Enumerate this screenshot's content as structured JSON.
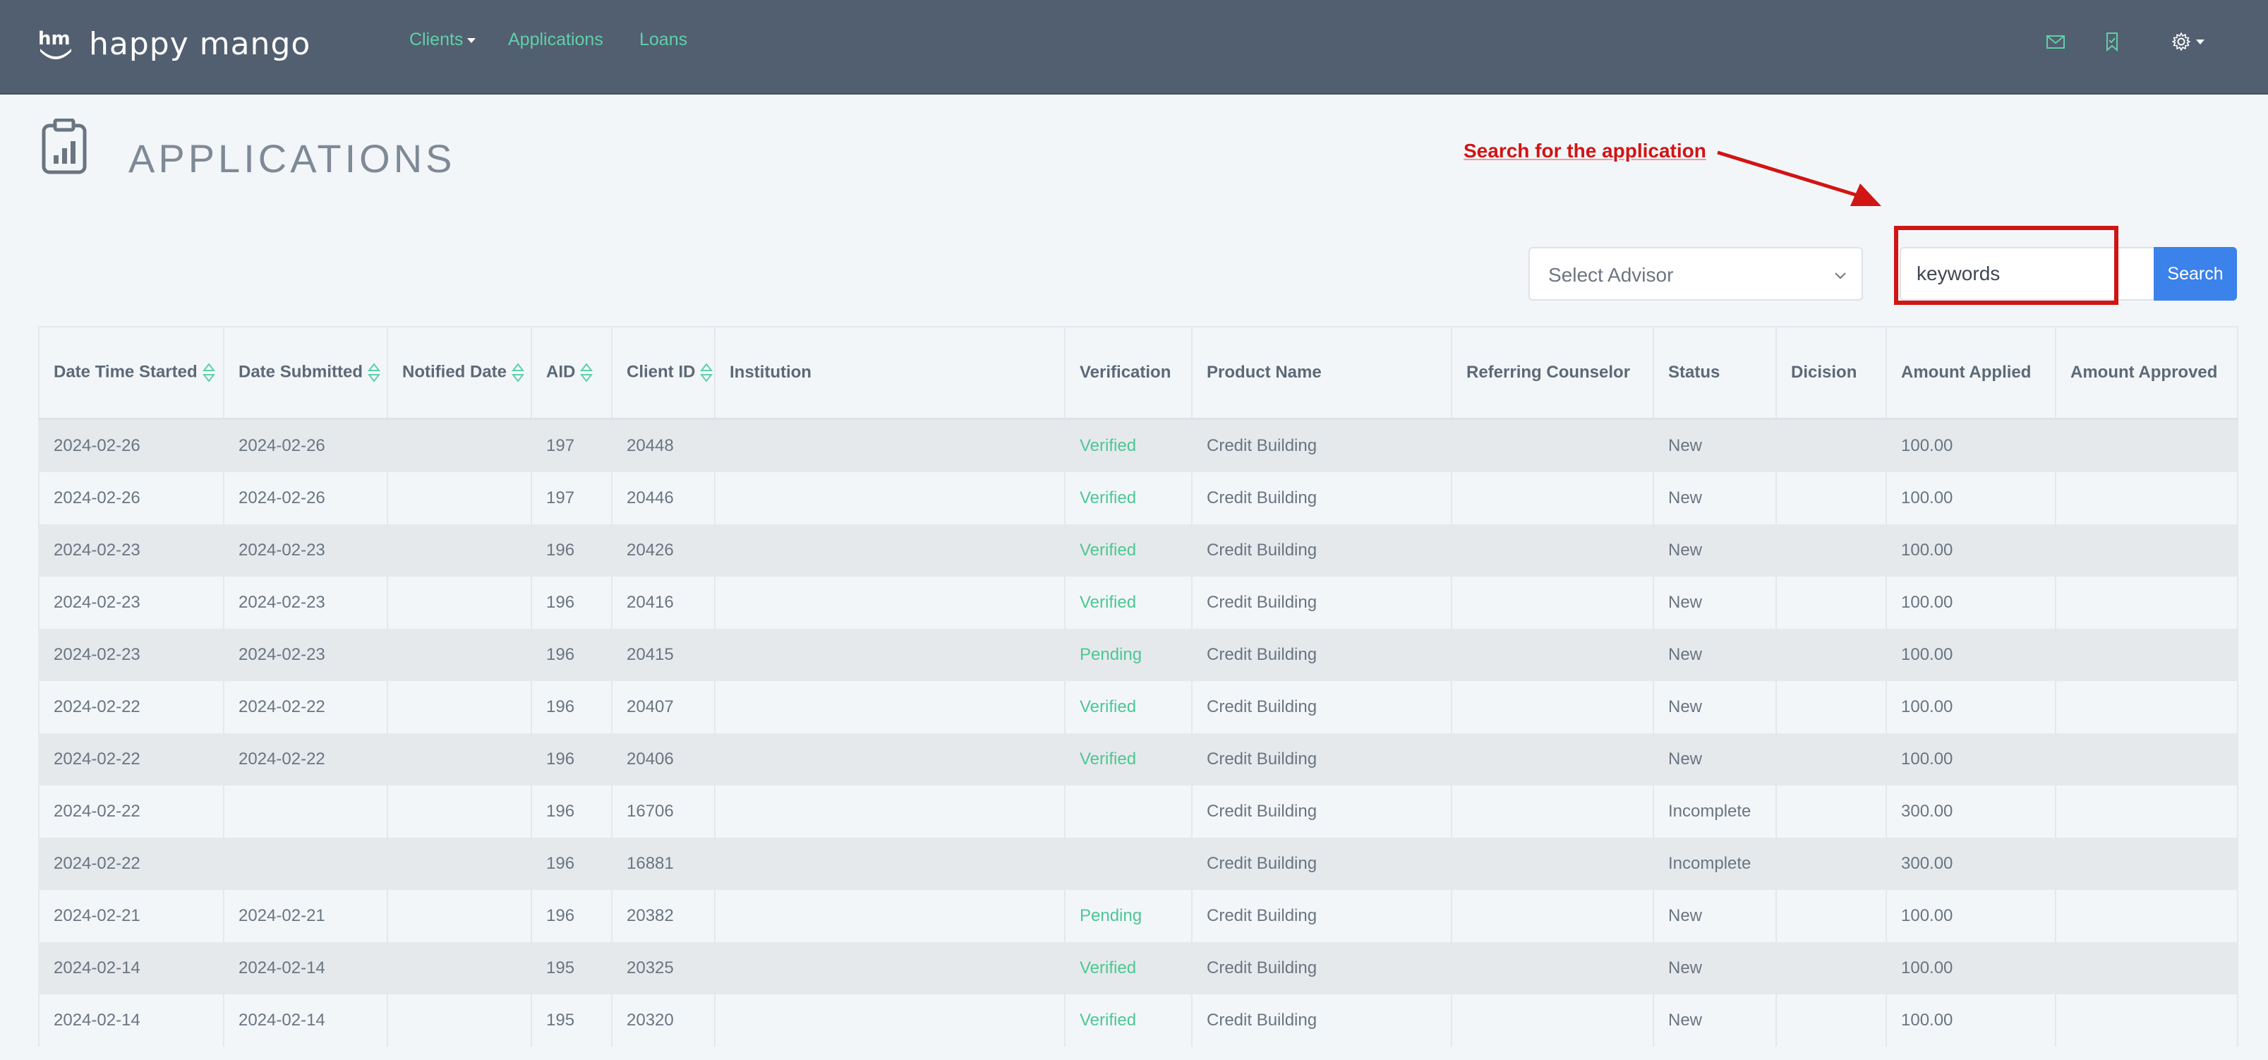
{
  "app": {
    "logo_text": "happy mango",
    "logo_mark": "hm",
    "nav": [
      {
        "label": "Clients",
        "has_dropdown": true
      },
      {
        "label": "Applications",
        "has_dropdown": false
      },
      {
        "label": "Loans",
        "has_dropdown": false
      }
    ],
    "icons": [
      "mail-icon",
      "bookmark-icon",
      "gear-icon"
    ],
    "accent_color": "#5fd0a8",
    "navbar_color": "#525f70"
  },
  "page": {
    "title": "APPLICATIONS",
    "icon": "clipboard-chart-icon"
  },
  "annotation": {
    "label": "Search for the application",
    "color": "#d11414"
  },
  "filters": {
    "advisor_placeholder": "Select Advisor",
    "search_value": "keywords",
    "search_button": "Search"
  },
  "table": {
    "columns": [
      {
        "label": "Date Time Started",
        "sortable": true
      },
      {
        "label": "Date Submitted",
        "sortable": true
      },
      {
        "label": "Notified Date",
        "sortable": true
      },
      {
        "label": "AID",
        "sortable": true
      },
      {
        "label": "Client ID",
        "sortable": true
      },
      {
        "label": "Institution",
        "sortable": false
      },
      {
        "label": "Verification",
        "sortable": false
      },
      {
        "label": "Product Name",
        "sortable": false
      },
      {
        "label": "Referring Counselor",
        "sortable": false
      },
      {
        "label": "Status",
        "sortable": false
      },
      {
        "label": "Dicision",
        "sortable": false
      },
      {
        "label": "Amount Applied",
        "sortable": false
      },
      {
        "label": "Amount Approved",
        "sortable": false
      }
    ],
    "rows": [
      [
        "2024-02-26",
        "2024-02-26",
        "",
        "197",
        "20448",
        "",
        "Verified",
        "Credit Building",
        "",
        "New",
        "",
        "100.00",
        ""
      ],
      [
        "2024-02-26",
        "2024-02-26",
        "",
        "197",
        "20446",
        "",
        "Verified",
        "Credit Building",
        "",
        "New",
        "",
        "100.00",
        ""
      ],
      [
        "2024-02-23",
        "2024-02-23",
        "",
        "196",
        "20426",
        "",
        "Verified",
        "Credit Building",
        "",
        "New",
        "",
        "100.00",
        ""
      ],
      [
        "2024-02-23",
        "2024-02-23",
        "",
        "196",
        "20416",
        "",
        "Verified",
        "Credit Building",
        "",
        "New",
        "",
        "100.00",
        ""
      ],
      [
        "2024-02-23",
        "2024-02-23",
        "",
        "196",
        "20415",
        "",
        "Pending",
        "Credit Building",
        "",
        "New",
        "",
        "100.00",
        ""
      ],
      [
        "2024-02-22",
        "2024-02-22",
        "",
        "196",
        "20407",
        "",
        "Verified",
        "Credit Building",
        "",
        "New",
        "",
        "100.00",
        ""
      ],
      [
        "2024-02-22",
        "2024-02-22",
        "",
        "196",
        "20406",
        "",
        "Verified",
        "Credit Building",
        "",
        "New",
        "",
        "100.00",
        ""
      ],
      [
        "2024-02-22",
        "",
        "",
        "196",
        "16706",
        "",
        "",
        "Credit Building",
        "",
        "Incomplete",
        "",
        "300.00",
        ""
      ],
      [
        "2024-02-22",
        "",
        "",
        "196",
        "16881",
        "",
        "",
        "Credit Building",
        "",
        "Incomplete",
        "",
        "300.00",
        ""
      ],
      [
        "2024-02-21",
        "2024-02-21",
        "",
        "196",
        "20382",
        "",
        "Pending",
        "Credit Building",
        "",
        "New",
        "",
        "100.00",
        ""
      ],
      [
        "2024-02-14",
        "2024-02-14",
        "",
        "195",
        "20325",
        "",
        "Verified",
        "Credit Building",
        "",
        "New",
        "",
        "100.00",
        ""
      ],
      [
        "2024-02-14",
        "2024-02-14",
        "",
        "195",
        "20320",
        "",
        "Verified",
        "Credit Building",
        "",
        "New",
        "",
        "100.00",
        ""
      ]
    ]
  }
}
